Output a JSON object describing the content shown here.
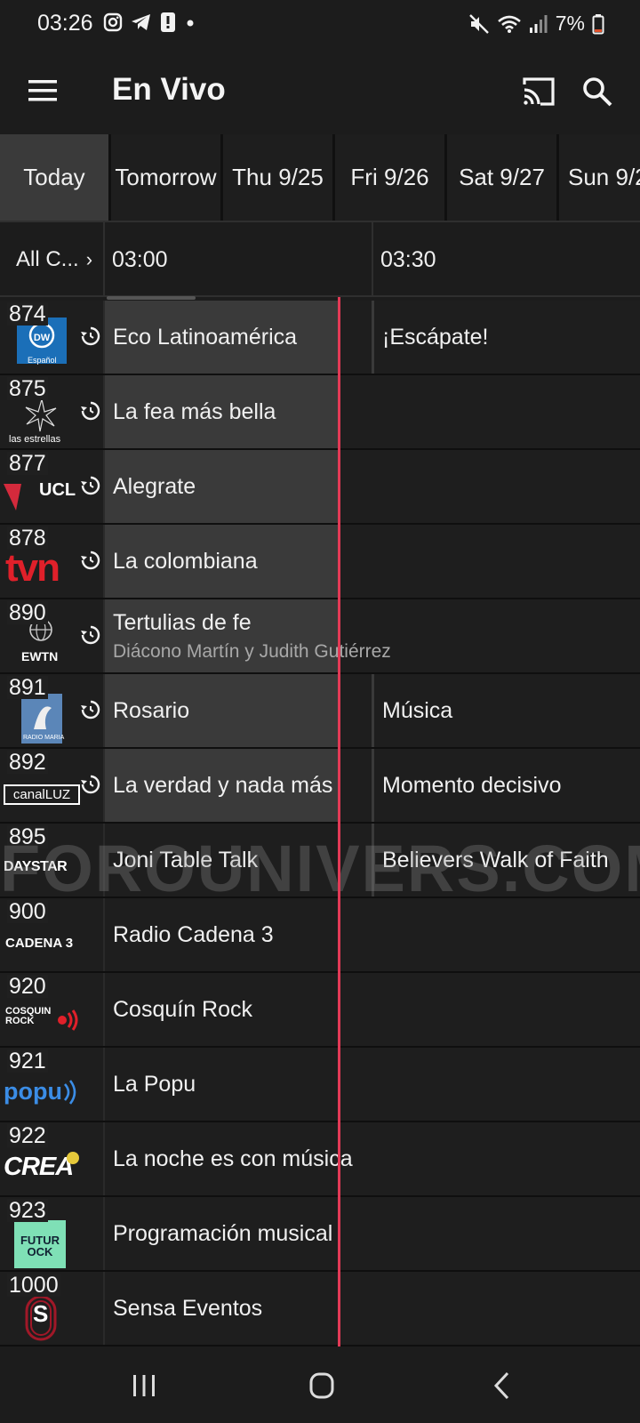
{
  "status_bar": {
    "time": "03:26",
    "battery": "7%",
    "icons_left": [
      "instagram-icon",
      "telegram-icon",
      "alert-icon",
      "dot-icon"
    ],
    "icons_right": [
      "mute-icon",
      "wifi-icon",
      "signal-icon",
      "battery-icon"
    ]
  },
  "app_bar": {
    "title": "En Vivo"
  },
  "day_tabs": [
    {
      "label": "Today",
      "active": true
    },
    {
      "label": "Tomorrow",
      "active": false
    },
    {
      "label": "Thu 9/25",
      "active": false
    },
    {
      "label": "Fri 9/26",
      "active": false
    },
    {
      "label": "Sat 9/27",
      "active": false
    },
    {
      "label": "Sun 9/2",
      "active": false
    }
  ],
  "time_header": {
    "channels_filter": "All C...",
    "slots": [
      "03:00",
      "03:30"
    ]
  },
  "channels": [
    {
      "number": "874",
      "logo": "DW Español",
      "logo_sub": "Español",
      "replay": true,
      "current": "Eco Latinoamérica",
      "next": "¡Escápate!"
    },
    {
      "number": "875",
      "logo": "las estrellas",
      "replay": true,
      "current": "La fea más bella",
      "next": ""
    },
    {
      "number": "877",
      "logo": "UCL",
      "replay": true,
      "current": "Alegrate",
      "next": ""
    },
    {
      "number": "878",
      "logo": "tvn",
      "replay": true,
      "current": "La colombiana",
      "next": ""
    },
    {
      "number": "890",
      "logo": "EWTN",
      "replay": true,
      "current": "Tertulias de fe",
      "current_sub": "Diácono Martín y Judith Gutiérrez",
      "next": ""
    },
    {
      "number": "891",
      "logo": "RADIO MARIA",
      "replay": true,
      "current": "Rosario",
      "next": "Música"
    },
    {
      "number": "892",
      "logo": "canalLUZ",
      "replay": true,
      "current": "La verdad y nada más",
      "next": "Momento decisivo"
    },
    {
      "number": "895",
      "logo": "DAYSTAR",
      "replay": false,
      "current": "Joni Table Talk",
      "next": "Believers Walk of Faith"
    },
    {
      "number": "900",
      "logo": "CADENA 3",
      "replay": false,
      "current": "Radio Cadena 3",
      "next": ""
    },
    {
      "number": "920",
      "logo": "COSQUIN ROCK",
      "replay": false,
      "current": "Cosquín Rock",
      "next": ""
    },
    {
      "number": "921",
      "logo": "popu",
      "replay": false,
      "current": "La Popu",
      "next": ""
    },
    {
      "number": "922",
      "logo": "CREA",
      "replay": false,
      "current": "La noche es con música",
      "next": ""
    },
    {
      "number": "923",
      "logo": "FUTUROCK",
      "replay": false,
      "current": "Programación musical",
      "next": ""
    },
    {
      "number": "1000",
      "logo": "S",
      "replay": false,
      "current": "Sensa Eventos",
      "next": ""
    }
  ],
  "watermark": "FOROUNIVERS.COM",
  "colors": {
    "background": "#1c1c1c",
    "current_program": "#3a3a3a",
    "now_line": "#e23a56"
  },
  "nav_bar": {
    "icons": [
      "recent-apps-icon",
      "home-icon",
      "back-icon"
    ]
  }
}
